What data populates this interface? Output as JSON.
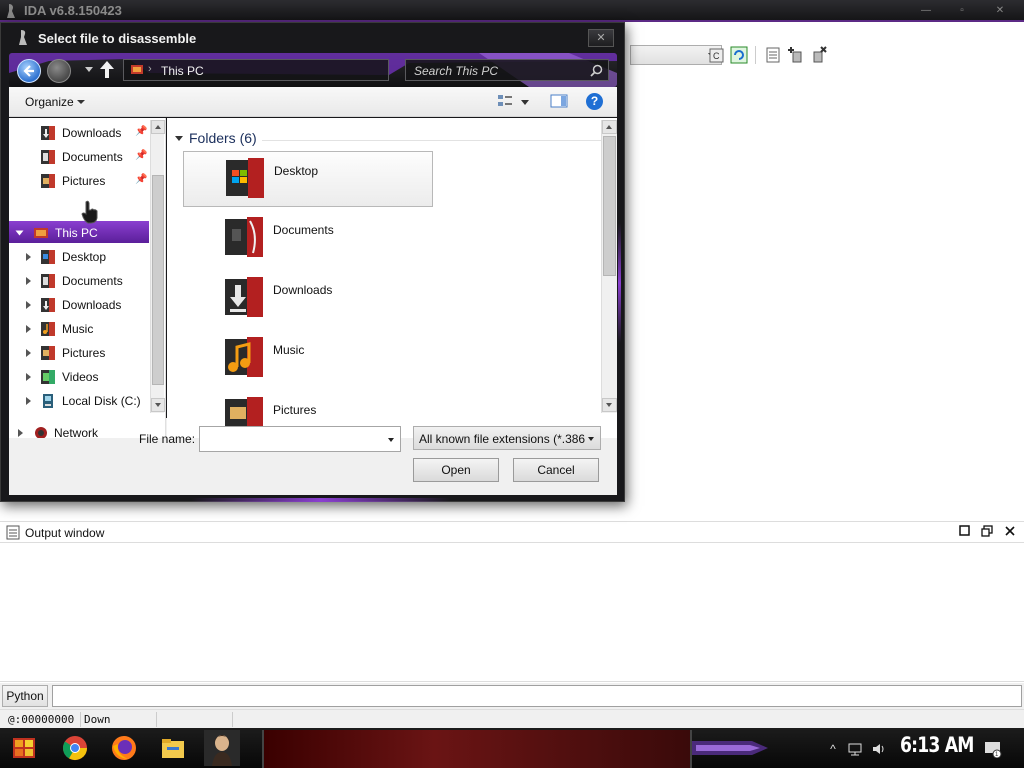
{
  "ida": {
    "title": "IDA v6.8.150423",
    "window_buttons": [
      "—",
      "▫",
      "✕"
    ]
  },
  "dialog": {
    "title": "Select file to disassemble",
    "close": "✕",
    "address": "This PC",
    "search_placeholder": "Search This PC",
    "organize": "Organize",
    "help": "?",
    "nav_items": [
      {
        "label": "Downloads",
        "pinned": true
      },
      {
        "label": "Documents",
        "pinned": true
      },
      {
        "label": "Pictures",
        "pinned": true
      },
      {
        "label": "This PC",
        "selected": true
      },
      {
        "label": "Desktop"
      },
      {
        "label": "Documents"
      },
      {
        "label": "Downloads"
      },
      {
        "label": "Music"
      },
      {
        "label": "Pictures"
      },
      {
        "label": "Videos"
      },
      {
        "label": "Local Disk (C:)"
      },
      {
        "label": "Network"
      }
    ],
    "folders_header": "Folders (6)",
    "folders": [
      {
        "label": "Desktop",
        "selected": true
      },
      {
        "label": "Documents"
      },
      {
        "label": "Downloads"
      },
      {
        "label": "Music"
      },
      {
        "label": "Pictures"
      }
    ],
    "file_name_label": "File name:",
    "file_name_value": "",
    "file_type": "All known file extensions (*.386",
    "open_button": "Open",
    "cancel_button": "Cancel"
  },
  "output": {
    "title": "Output window",
    "python_button": "Python",
    "status_address": "@:00000000",
    "status_direction": "Down"
  },
  "taskbar": {
    "clock": "6:13 AM"
  },
  "colors": {
    "accent_purple": "#7b34c2",
    "selection_blue": "#2f72d0"
  }
}
